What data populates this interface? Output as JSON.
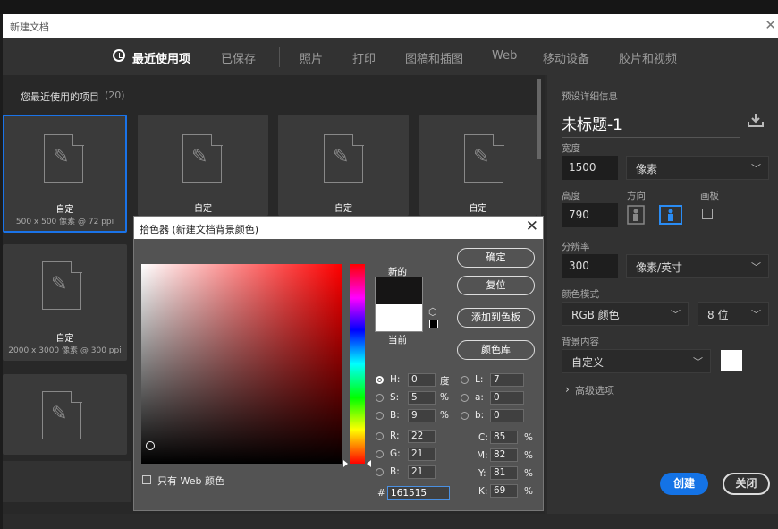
{
  "window": {
    "title": "新建文档",
    "close": "✕"
  },
  "tabs": [
    {
      "label": "最近使用项",
      "active": true
    },
    {
      "label": "已保存"
    },
    {
      "label": "照片"
    },
    {
      "label": "打印"
    },
    {
      "label": "图稿和插图"
    },
    {
      "label": "Web"
    },
    {
      "label": "移动设备"
    },
    {
      "label": "胶片和视频"
    }
  ],
  "recent": {
    "title": "您最近使用的项目",
    "count": "(20)",
    "items": [
      {
        "name": "自定",
        "sub": "500 x 500 像素 @ 72 ppi"
      },
      {
        "name": "自定",
        "sub": ""
      },
      {
        "name": "自定",
        "sub": ""
      },
      {
        "name": "自定",
        "sub": ""
      },
      {
        "name": "自定",
        "sub": "2000 x 3000 像素 @ 300 ppi"
      },
      {
        "name": "",
        "sub": ""
      }
    ]
  },
  "preset": {
    "header": "预设详细信息",
    "doc_name": "未标题-1",
    "width_label": "宽度",
    "width_value": "1500",
    "width_unit": "像素",
    "height_label": "高度",
    "height_value": "790",
    "orientation_label": "方向",
    "artboard_label": "画板",
    "resolution_label": "分辨率",
    "resolution_value": "300",
    "resolution_unit": "像素/英寸",
    "color_mode_label": "颜色模式",
    "color_mode": "RGB 颜色",
    "bit_depth": "8 位",
    "bg_label": "背景内容",
    "bg_value": "自定义",
    "advanced": "高级选项",
    "create": "创建",
    "close": "关闭"
  },
  "picker": {
    "title": "拾色器 (新建文档背景颜色)",
    "close": "✕",
    "new_label": "新的",
    "current_label": "当前",
    "new_color": "#161515",
    "current_color": "#ffffff",
    "ok": "确定",
    "reset": "复位",
    "add_swatch": "添加到色板",
    "libraries": "颜色库",
    "web_only": "只有 Web 颜色",
    "H": "0",
    "S": "5",
    "B": "9",
    "R": "22",
    "G": "21",
    "Bv": "21",
    "L": "7",
    "a": "0",
    "b": "0",
    "C": "85",
    "M": "82",
    "Y": "81",
    "K": "69",
    "hex": "161515",
    "deg": "度",
    "pct": "%"
  }
}
